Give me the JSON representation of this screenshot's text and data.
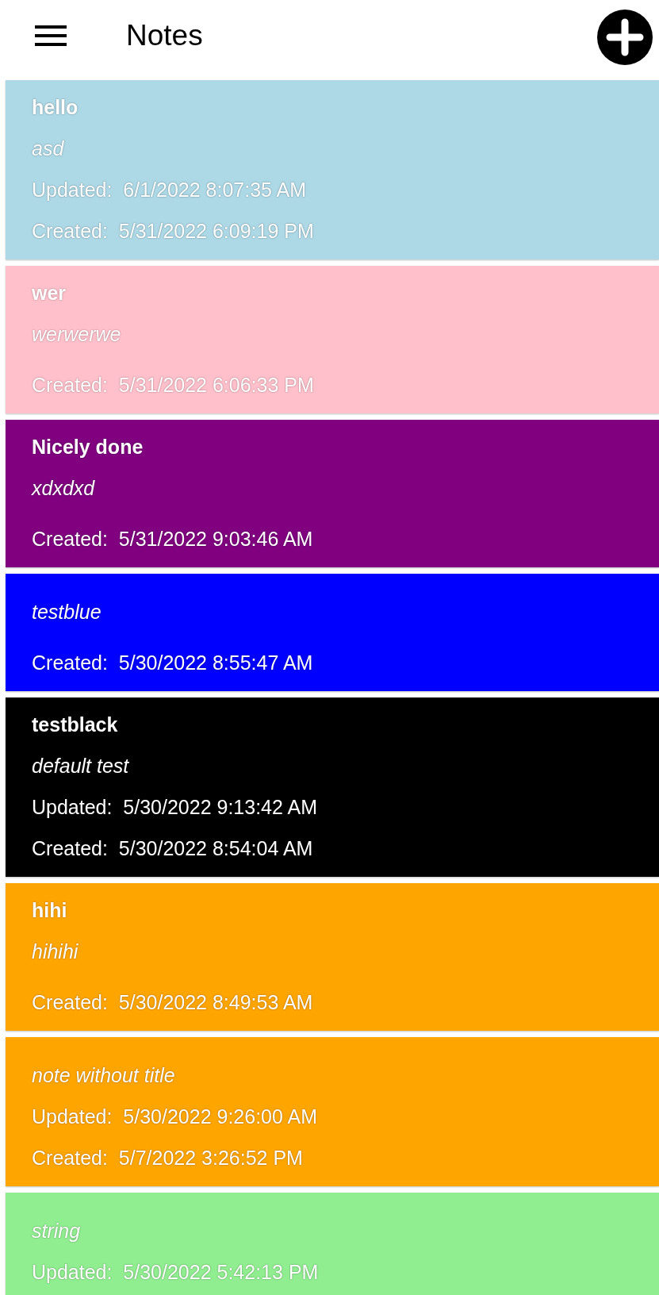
{
  "app_bar": {
    "title": "Notes"
  },
  "notes": [
    {
      "title": "hello",
      "text": "asd",
      "updated": "Updated:  6/1/2022 8:07:35 AM",
      "created": "Created:  5/31/2022 6:09:19 PM",
      "color": "#add8e6"
    },
    {
      "title": "wer",
      "text": "werwerwe",
      "created": "Created:  5/31/2022 6:06:33 PM",
      "color": "#ffc0cb"
    },
    {
      "title": "Nicely done",
      "text": "xdxdxd",
      "created": "Created:  5/31/2022 9:03:46 AM",
      "color": "#800080"
    },
    {
      "text": "testblue",
      "created": "Created:  5/30/2022 8:55:47 AM",
      "color": "#0000ff"
    },
    {
      "title": "testblack",
      "text": "default test",
      "updated": "Updated:  5/30/2022 9:13:42 AM",
      "created": "Created:  5/30/2022 8:54:04 AM",
      "color": "#000000"
    },
    {
      "title": "hihi",
      "text": "hihihi",
      "created": "Created:  5/30/2022 8:49:53 AM",
      "color": "#ffa500"
    },
    {
      "text": "note without title",
      "updated": "Updated:  5/30/2022 9:26:00 AM",
      "created": "Created:  5/7/2022 3:26:52 PM",
      "color": "#ffa500"
    },
    {
      "text": "string",
      "updated": "Updated:  5/30/2022 5:42:13 PM",
      "color": "#90ee90"
    }
  ]
}
